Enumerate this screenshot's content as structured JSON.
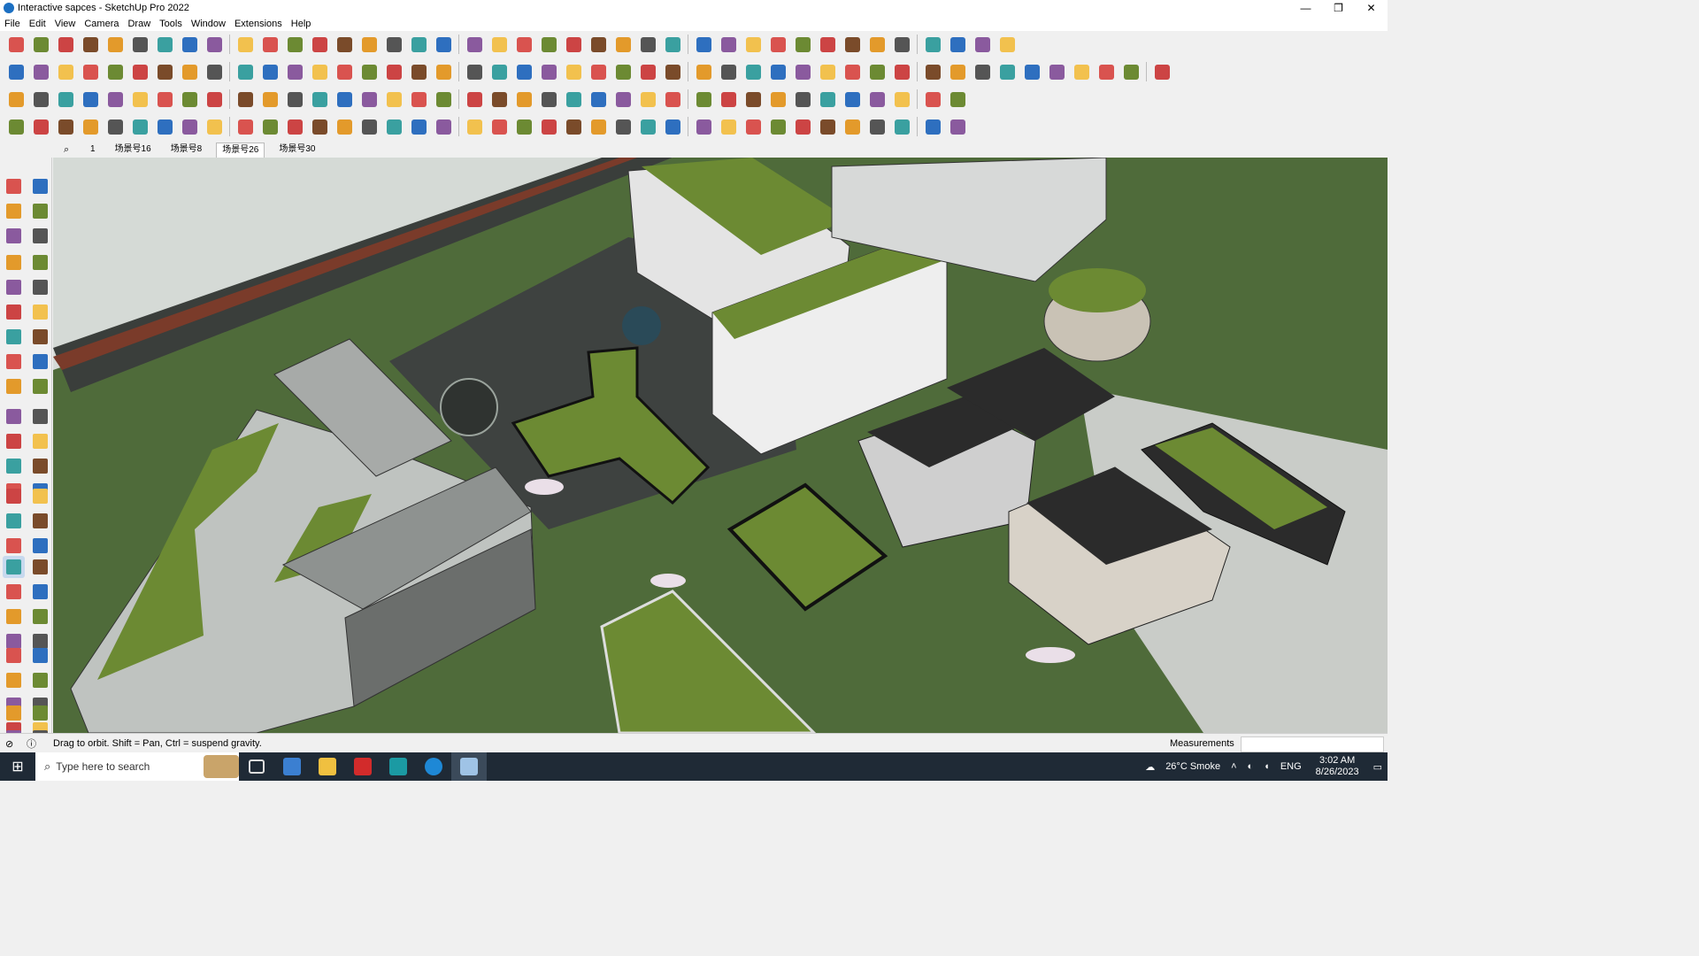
{
  "window": {
    "title": "Interactive sapces - SketchUp Pro 2022",
    "controls": [
      "—",
      "❐",
      "✕"
    ]
  },
  "menu": [
    "File",
    "Edit",
    "View",
    "Camera",
    "Draw",
    "Tools",
    "Window",
    "Extensions",
    "Help"
  ],
  "scenes": {
    "search_value": "1",
    "tabs": [
      "场景号16",
      "场景号8",
      "场景号26",
      "场景号30"
    ],
    "active_tab": "场景号26"
  },
  "status": {
    "hint": "Drag to orbit. Shift = Pan, Ctrl = suspend gravity.",
    "measurements_label": "Measurements",
    "measurements_value": ""
  },
  "taskbar": {
    "search_placeholder": "Type here to search",
    "weather": "26°C  Smoke",
    "lang": "ENG",
    "time": "3:02 AM",
    "date": "8/26/2023"
  },
  "colors": {
    "accent": "#1b6fc2",
    "grass": "#5b7a2c",
    "roof_dark": "#2b2b2b"
  }
}
